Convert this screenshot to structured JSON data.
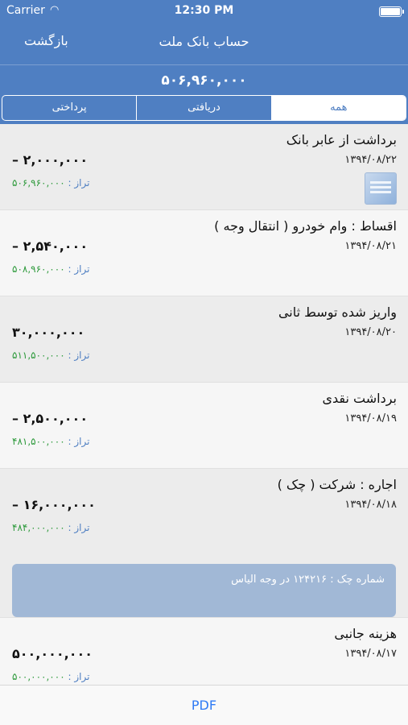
{
  "status_bar": {
    "carrier": "Carrier",
    "time": "12:30 PM"
  },
  "nav": {
    "title": "حساب بانک ملت",
    "back_label": "بازگشت"
  },
  "balance": "۵۰۶,۹۶۰,۰۰۰",
  "segments": [
    "پرداختی",
    "دریافتی",
    "همه"
  ],
  "active_segment": "همه",
  "transactions": [
    {
      "title": "برداشت از عابر بانک",
      "date": "۱۳۹۴/۰۸/۲۲",
      "amount": "– ۲,۰۰۰,۰۰۰",
      "balance_label": "تراز :",
      "balance_value": "۵۰۶,۹۶۰,۰۰۰"
    },
    {
      "title": "اقساط : وام خودرو ( انتقال وجه )",
      "date": "۱۳۹۴/۰۸/۲۱",
      "amount": "– ۲,۵۴۰,۰۰۰",
      "balance_label": "تراز :",
      "balance_value": "۵۰۸,۹۶۰,۰۰۰"
    },
    {
      "title": "واریز شده توسط ثانی",
      "date": "۱۳۹۴/۰۸/۲۰",
      "amount": "۳۰,۰۰۰,۰۰۰",
      "balance_label": "تراز :",
      "balance_value": "۵۱۱,۵۰۰,۰۰۰"
    },
    {
      "title": "برداشت نقدی",
      "date": "۱۳۹۴/۰۸/۱۹",
      "amount": "– ۲,۵۰۰,۰۰۰",
      "balance_label": "تراز :",
      "balance_value": "۴۸۱,۵۰۰,۰۰۰"
    },
    {
      "title": "اجاره : شرکت ( چک )",
      "date": "۱۳۹۴/۰۸/۱۸",
      "amount": "– ۱۶,۰۰۰,۰۰۰",
      "balance_label": "تراز :",
      "balance_value": "۴۸۴,۰۰۰,۰۰۰",
      "note": "شماره چک : ۱۲۴۲۱۶ در وجه الیاس"
    },
    {
      "title": "هزینه جانبی",
      "date": "۱۳۹۴/۰۸/۱۷",
      "amount": "۵۰۰,۰۰۰,۰۰۰",
      "balance_label": "تراز :",
      "balance_value": "۵۰۰,۰۰۰,۰۰۰"
    }
  ],
  "toolbar": {
    "pdf_label": "PDF"
  },
  "colors": {
    "primary": "#4f7fc2",
    "balance_value": "#2e9a3c",
    "link": "#2f7bf5",
    "note_bg": "#a1b8d6"
  }
}
